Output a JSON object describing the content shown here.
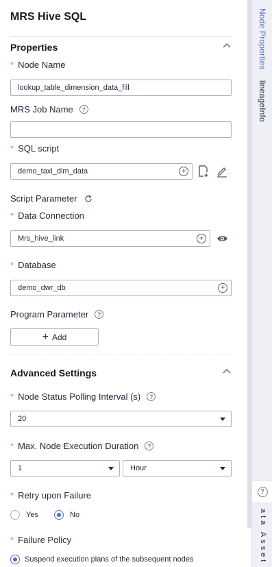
{
  "panel": {
    "title": "MRS Hive SQL"
  },
  "properties": {
    "heading": "Properties",
    "node_name": {
      "label": "Node Name",
      "value": "lookup_table_dimension_data_fill"
    },
    "mrs_job_name": {
      "label": "MRS Job Name",
      "value": ""
    },
    "sql_script": {
      "label": "SQL script",
      "value": "demo_taxi_dim_data"
    },
    "script_parameter": {
      "label": "Script Parameter"
    },
    "data_connection": {
      "label": "Data Connection",
      "value": "Mrs_hive_link"
    },
    "database": {
      "label": "Database",
      "value": "demo_dwr_db"
    },
    "program_parameter": {
      "label": "Program Parameter",
      "add_label": "Add"
    }
  },
  "advanced": {
    "heading": "Advanced Settings",
    "polling_interval": {
      "label": "Node Status Polling Interval (s)",
      "value": "20"
    },
    "max_duration": {
      "label": "Max. Node Execution Duration",
      "value": "1",
      "unit": "Hour"
    },
    "retry": {
      "label": "Retry upon Failure",
      "options": [
        "Yes",
        "No"
      ],
      "selected": "No"
    },
    "failure_policy": {
      "label": "Failure Policy",
      "option": "Suspend execution plans of the subsequent nodes"
    }
  },
  "rail": {
    "tabs": [
      "Node Properties",
      "lineageInfo"
    ],
    "active_tab": "Node Properties",
    "bottom_label": "ata Asset"
  },
  "colors": {
    "accent": "#526ecc",
    "required": "#f66f6a",
    "border": "#adb0b8"
  }
}
